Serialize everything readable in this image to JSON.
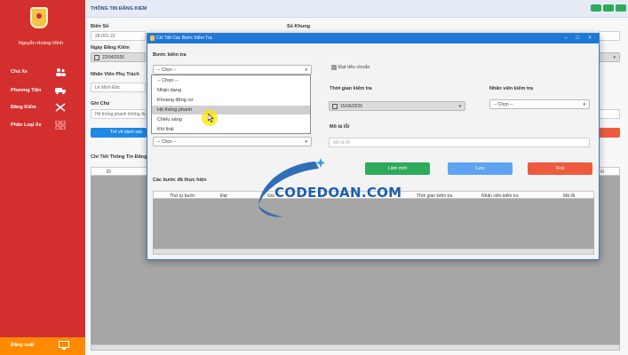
{
  "sidebar": {
    "user_name": "Nguyễn Hoàng Minh",
    "items": [
      {
        "label": "Chủ Xe",
        "icon": "users-icon"
      },
      {
        "label": "Phương Tiện",
        "icon": "truck-icon"
      },
      {
        "label": "Đăng Kiểm",
        "icon": "tools-icon"
      },
      {
        "label": "Phân Loại Xe",
        "icon": "grid-icon"
      }
    ],
    "logout_label": "Đăng xuất",
    "colors": {
      "sidebar_bg": "#d32f2f",
      "logout_bg": "#ff8a00"
    }
  },
  "window": {
    "title": "THÔNG TIN ĐĂNG KIỂM"
  },
  "form": {
    "bien_so_label": "Biển Số",
    "bien_so_value": "28-001.23",
    "so_khung_label": "Số Khung",
    "ngay_dang_kiem_label": "Ngày Đăng Kiểm",
    "ngay_dang_kiem_value": "22/04/2026",
    "nhan_vien_label": "Nhân Viên Phụ Trách",
    "nhan_vien_value": "Lê Minh Đức",
    "ghi_chu_label": "Ghi Chú",
    "ghi_chu_value": "Hệ thống phanh không đạ",
    "back_button_label": "Trở về danh sác"
  },
  "details_table": {
    "title": "Chi Tiết Thông Tin Đăng",
    "columns": [
      "ID"
    ],
    "extra_col": "ỗi"
  },
  "modal": {
    "title": "Chi Tiết Các Bước Kiểm Tra",
    "buoc_label": "Bước kiểm tra",
    "buoc_value": "-- Chọn --",
    "options": [
      "-- Chọn --",
      "Nhận dạng",
      "Khoang động cơ",
      "Hệ thống phanh",
      "Chiếu sáng",
      "Khí thải"
    ],
    "highlighted_option": "Hệ thống phanh",
    "second_select_value": "-- Chọn --",
    "dat_label": "Đạt tiêu chuẩn",
    "thoi_gian_label": "Thời gian kiểm tra",
    "thoi_gian_value": "15/06/2026",
    "nv_kiem_tra_label": "Nhân viên kiểm tra",
    "nv_kiem_tra_value": "-- Chọn --",
    "mo_ta_label": "Mô tả lỗi",
    "mo_ta_placeholder": "Mô tả lỗi",
    "buttons": {
      "new": "Làm mới",
      "save": "Lưu",
      "delete": "Xoá"
    },
    "done_title": "Các bước đã thực hiện",
    "done_columns": [
      "Thứ tự bước",
      "Đạt",
      "Gia",
      "Thời gian kiểm tra",
      "Nhân viên kiểm tra",
      "Mã lỗi"
    ],
    "colors": {
      "new": "#2eaa5b",
      "save": "#5ea4f0",
      "delete": "#ee5a3e"
    }
  },
  "watermark": {
    "text": "CODEDOAN.COM"
  }
}
